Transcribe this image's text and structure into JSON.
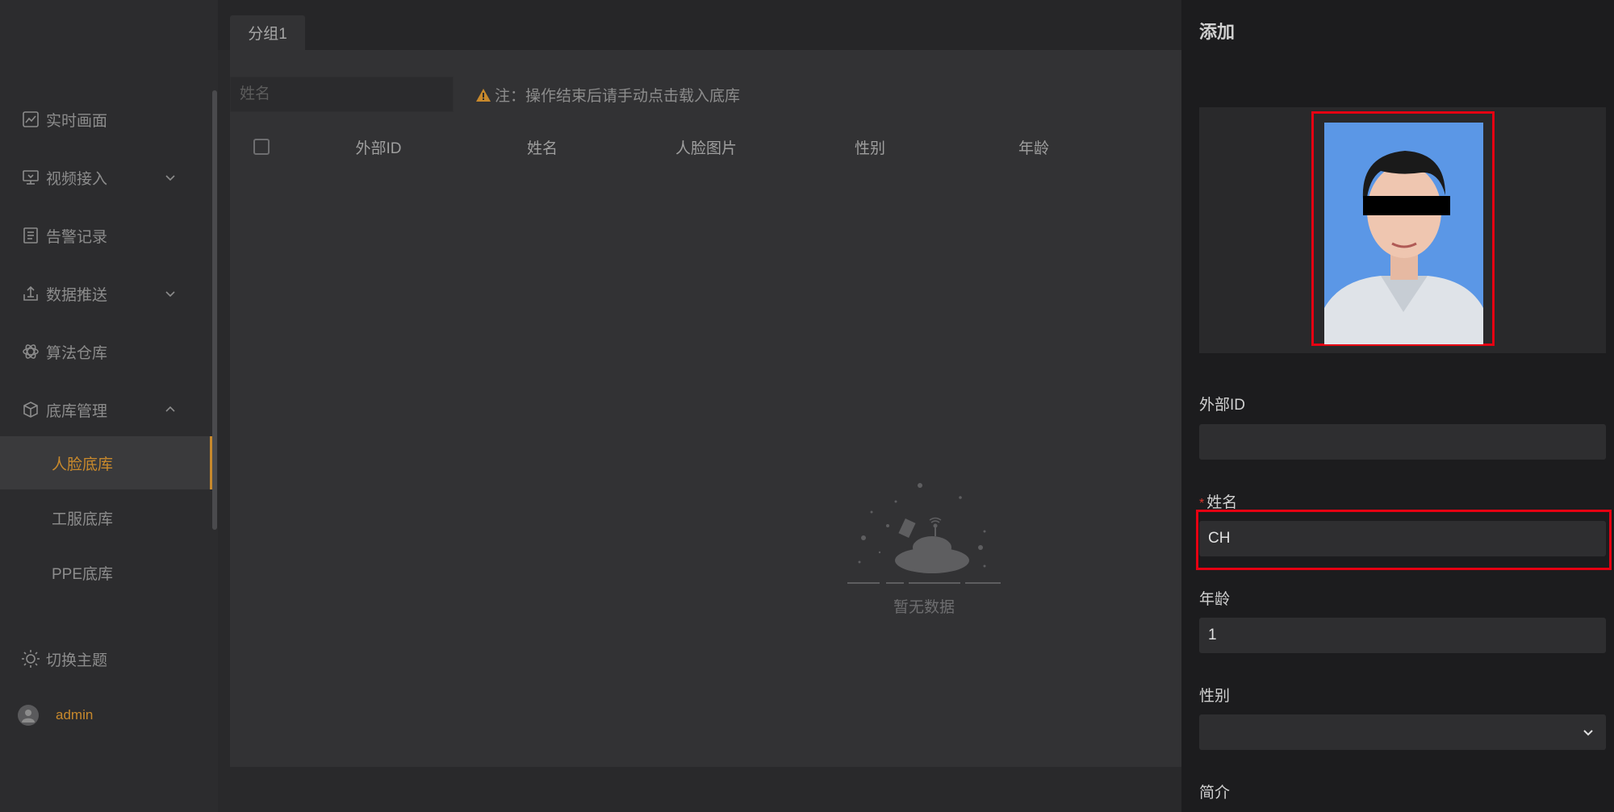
{
  "sidebar": {
    "items": [
      {
        "label": "实时画面",
        "icon": "line-chart-icon"
      },
      {
        "label": "视频接入",
        "icon": "monitor-icon"
      },
      {
        "label": "告警记录",
        "icon": "document-icon"
      },
      {
        "label": "数据推送",
        "icon": "upload-icon"
      },
      {
        "label": "算法仓库",
        "icon": "atom-icon"
      },
      {
        "label": "底库管理",
        "icon": "cube-icon"
      }
    ],
    "sub_items": [
      "人脸底库",
      "工服底库",
      "PPE底库"
    ],
    "theme_label": "切换主题",
    "user_name": "admin"
  },
  "main": {
    "tab_label": "分组1",
    "search_placeholder": "姓名",
    "notice": "注：操作结束后请手动点击载入底库",
    "columns": [
      "外部ID",
      "姓名",
      "人脸图片",
      "性别",
      "年龄"
    ],
    "empty_text": "暂无数据"
  },
  "drawer": {
    "title": "添加",
    "fields": {
      "external_id_label": "外部ID",
      "external_id_value": "",
      "name_label": "姓名",
      "name_value": "CH",
      "age_label": "年龄",
      "age_value": "1",
      "gender_label": "性别",
      "gender_value": "",
      "bio_label": "简介"
    }
  },
  "colors": {
    "accent": "#c8892c",
    "highlight": "#e60012",
    "required": "#d9362c"
  }
}
